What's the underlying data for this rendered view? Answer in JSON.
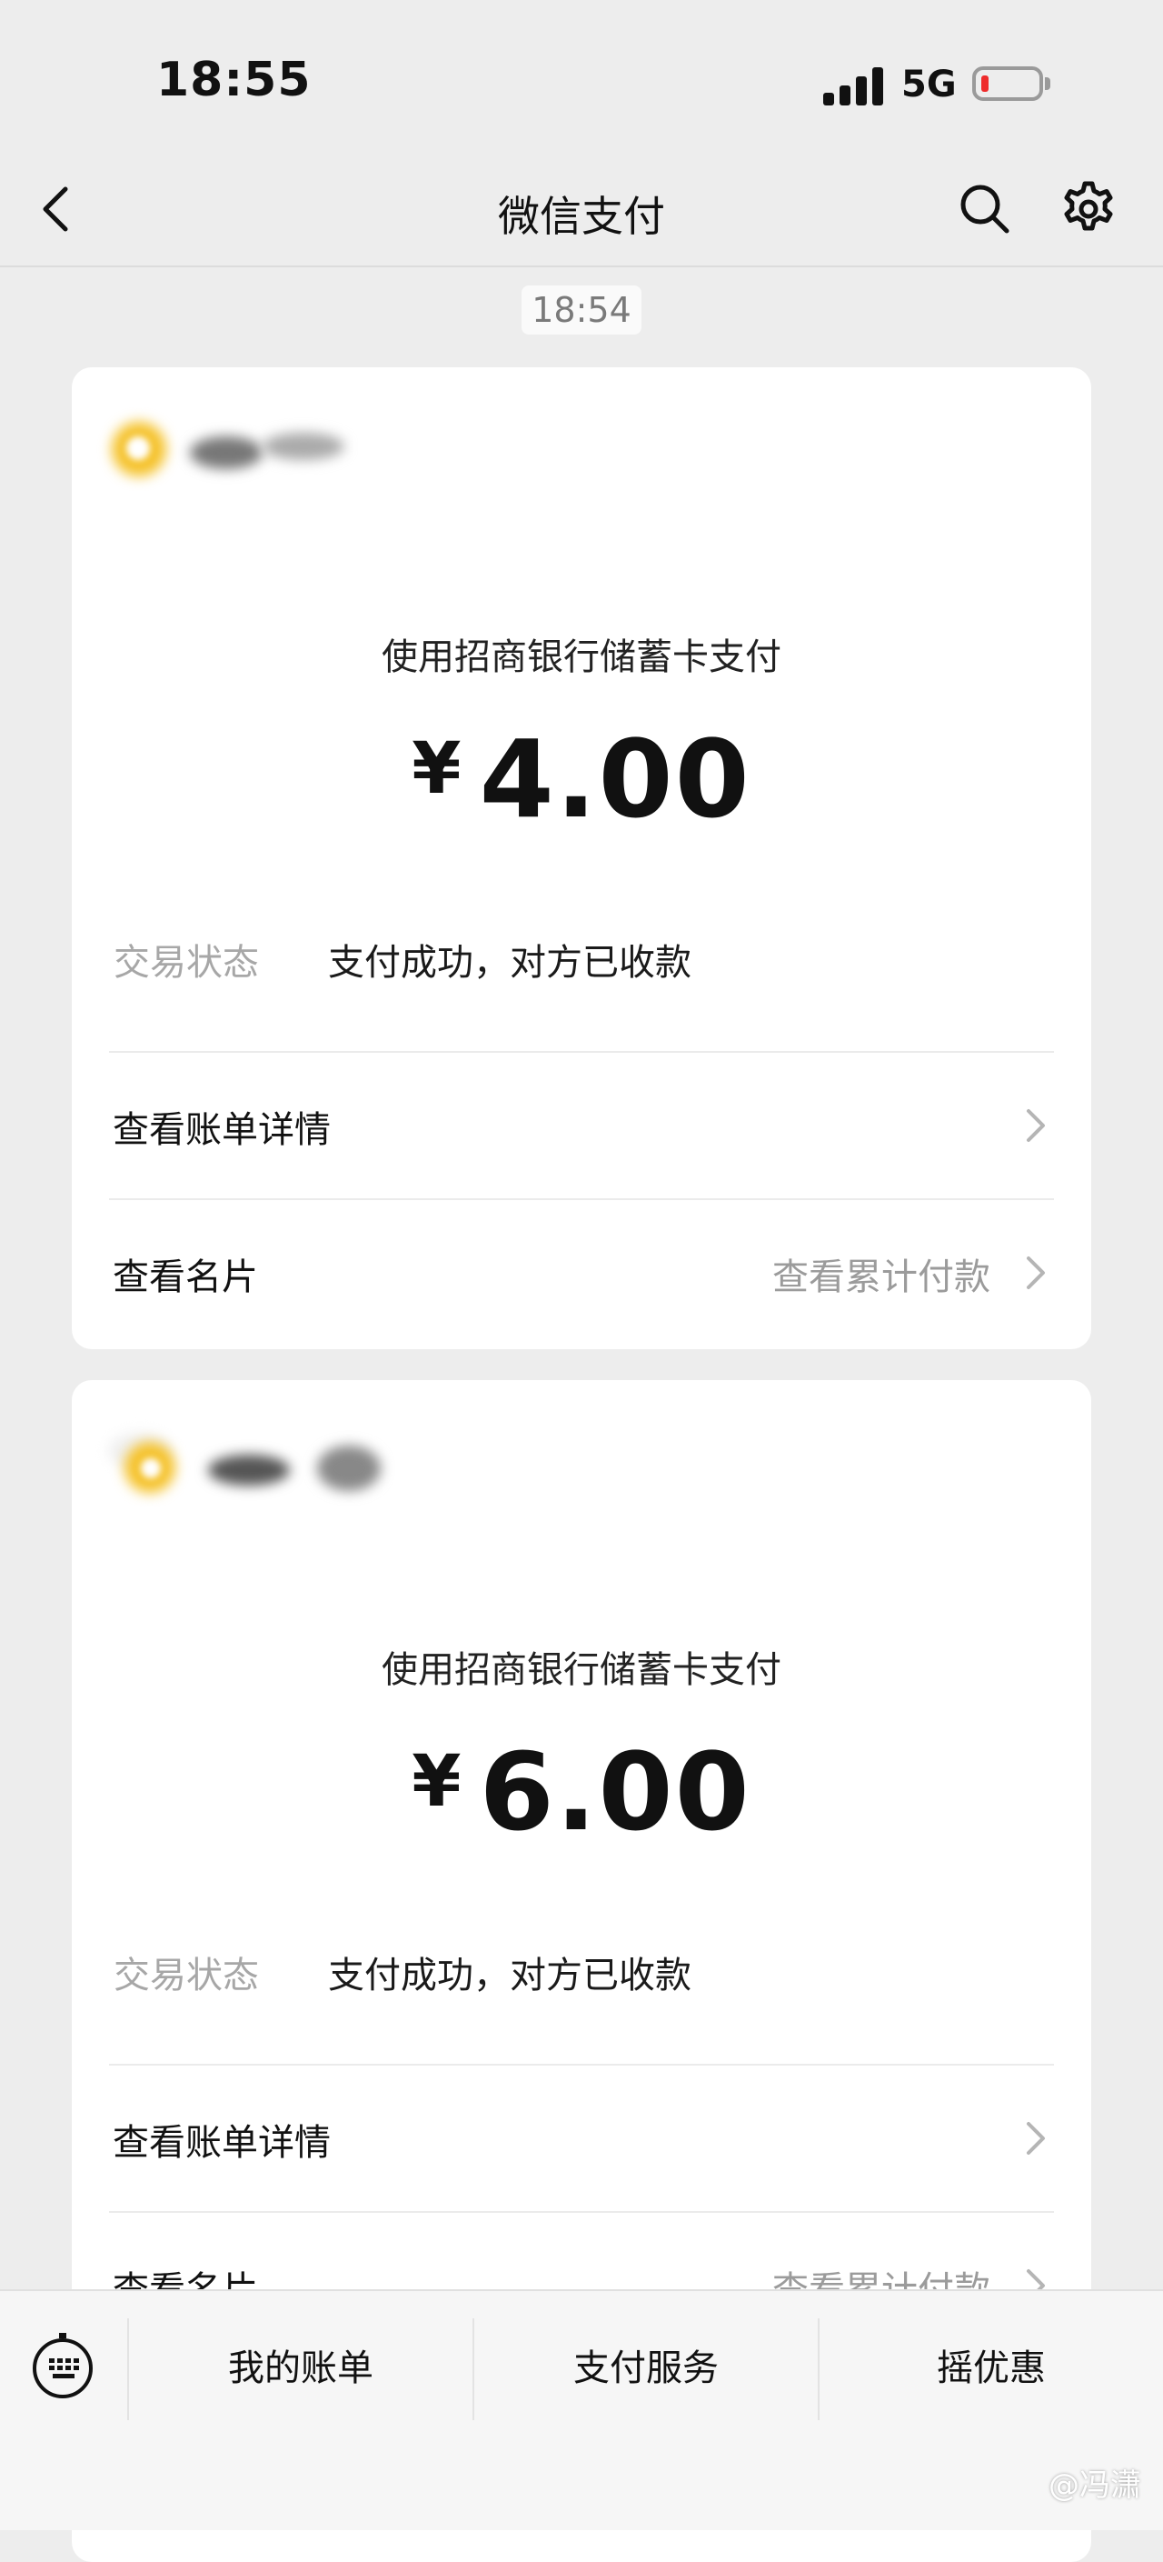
{
  "status_bar": {
    "time": "18:55",
    "network": "5G",
    "battery_color": "#ee2b2b"
  },
  "nav": {
    "title": "微信支付",
    "back_icon": "chevron-left-icon",
    "search_icon": "search-icon",
    "settings_icon": "gear-icon"
  },
  "timestamp": "18:54",
  "cards": [
    {
      "payment_method": "使用招商银行储蓄卡支付",
      "currency": "¥",
      "amount": "4.00",
      "status_label": "交易状态",
      "status_value": "支付成功，对方已收款",
      "bill_detail": "查看账单详情",
      "merchant_card": "查看名片",
      "cumulative": "查看累计付款"
    },
    {
      "payment_method": "使用招商银行储蓄卡支付",
      "currency": "¥",
      "amount": "6.00",
      "status_label": "交易状态",
      "status_value": "支付成功，对方已收款",
      "bill_detail": "查看账单详情",
      "merchant_card": "查看名片",
      "cumulative": "查看累计付款"
    }
  ],
  "bottom_bar": {
    "keyboard_icon": "keyboard-icon",
    "tabs": [
      "我的账单",
      "支付服务",
      "摇优惠"
    ]
  },
  "watermark": "@冯潇"
}
